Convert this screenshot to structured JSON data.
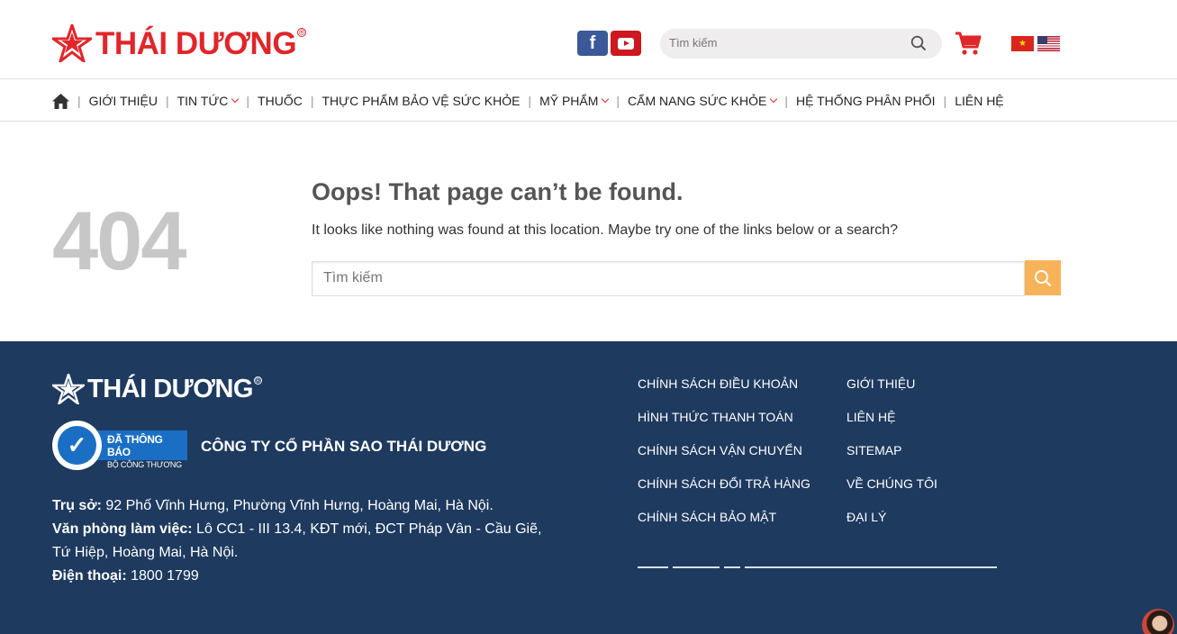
{
  "header": {
    "logo_text": "THÁI DƯƠNG",
    "logo_mark": "®",
    "social": {
      "facebook_label": "f"
    },
    "search_placeholder": "Tìm kiếm"
  },
  "nav": {
    "items": [
      {
        "label": "GIỚI THIỆU",
        "dropdown": false
      },
      {
        "label": "TIN TỨC",
        "dropdown": true
      },
      {
        "label": "THUỐC",
        "dropdown": false
      },
      {
        "label": "THỰC PHẨM BẢO VỆ SỨC KHỎE",
        "dropdown": false
      },
      {
        "label": "MỸ PHẨM",
        "dropdown": true
      },
      {
        "label": "CẨM NANG SỨC KHỎE",
        "dropdown": true
      },
      {
        "label": "HỆ THỐNG PHÂN PHỐI",
        "dropdown": false
      },
      {
        "label": "LIÊN HỆ",
        "dropdown": false
      }
    ],
    "separator": "|"
  },
  "error": {
    "code": "404",
    "title": "Oops! That page can’t be found.",
    "description": "It looks like nothing was found at this location. Maybe try one of the links below or a search?",
    "search_placeholder": "Tìm kiếm"
  },
  "footer": {
    "logo_text": "THÁI DƯƠNG",
    "logo_mark": "®",
    "badge_line1": "ĐÃ THÔNG BÁO",
    "badge_line2": "BỘ CÔNG THƯƠNG",
    "company": "CÔNG TY CỔ PHẦN SAO THÁI DƯƠNG",
    "address_label": "Trụ sở:",
    "address_value": " 92 Phố Vĩnh Hưng, Phường Vĩnh Hưng, Hoàng Mai, Hà Nội.",
    "office_label": "Văn phòng làm việc:",
    "office_value": " Lô CC1 - III 13.4, KĐT mới, ĐCT Pháp Vân - Cầu Giẽ, Tứ Hiệp, Hoàng Mai, Hà Nội.",
    "phone_label": "Điện thoại:",
    "phone_value": " 1800 1799",
    "links_col1": [
      "CHÍNH SÁCH ĐIỀU KHOẢN",
      "HÌNH THỨC THANH TOÁN",
      "CHÍNH SÁCH VẬN CHUYỂN",
      "CHÍNH SÁCH ĐỔI TRẢ HÀNG",
      "CHÍNH SÁCH BẢO MẬT"
    ],
    "links_col2": [
      "GIỚI THIỆU",
      "LIÊN HỆ",
      "SITEMAP",
      "VỀ CHÚNG TÔI",
      "ĐẠI LÝ"
    ]
  },
  "colors": {
    "brand_red": "#e0262a",
    "footer_bg": "#1e3a5f",
    "search_button": "#f7b359",
    "error_code": "#c7c7c7"
  },
  "icons": [
    "star-logo-icon",
    "facebook-icon",
    "youtube-icon",
    "search-icon",
    "cart-icon",
    "vietnam-flag-icon",
    "us-flag-icon",
    "home-icon",
    "chevron-down-icon",
    "checkmark-badge-icon"
  ]
}
